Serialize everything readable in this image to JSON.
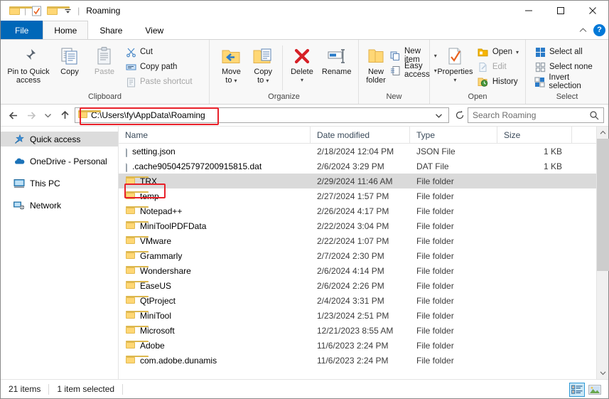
{
  "window": {
    "title": "Roaming",
    "quick_access_icons": [
      "folder-icon",
      "properties-check-icon",
      "new-folder-icon",
      "customize-qat-chevron-icon"
    ],
    "minimize_label": "—",
    "maximize_label": "□",
    "close_label": "✕",
    "ribbon_collapse_label": "∧",
    "help_label": "?"
  },
  "tabs": [
    {
      "label": "File",
      "kind": "file"
    },
    {
      "label": "Home",
      "kind": "active"
    },
    {
      "label": "Share",
      "kind": "normal"
    },
    {
      "label": "View",
      "kind": "normal"
    }
  ],
  "ribbon": {
    "groups": [
      {
        "label": "Clipboard",
        "big_buttons": [
          {
            "label_line1": "Pin to Quick",
            "label_line2": "access",
            "icon": "pin-icon"
          },
          {
            "label_line1": "Copy",
            "label_line2": "",
            "icon": "copy-icon"
          },
          {
            "label_line1": "Paste",
            "label_line2": "",
            "icon": "paste-icon",
            "disabled": true
          }
        ],
        "small_buttons": [
          {
            "label": "Cut",
            "icon": "scissors-icon",
            "disabled": false
          },
          {
            "label": "Copy path",
            "icon": "copy-path-icon",
            "disabled": false
          },
          {
            "label": "Paste shortcut",
            "icon": "paste-shortcut-icon",
            "disabled": true
          }
        ]
      },
      {
        "label": "Organize",
        "big_buttons": [
          {
            "label_line1": "Move",
            "label_line2": "to",
            "icon": "move-to-icon",
            "has_caret": true
          },
          {
            "label_line1": "Copy",
            "label_line2": "to",
            "icon": "copy-to-icon",
            "has_caret": true
          },
          {
            "label_line1": "Delete",
            "label_line2": "",
            "icon": "delete-x-icon",
            "has_caret": true
          },
          {
            "label_line1": "Rename",
            "label_line2": "",
            "icon": "rename-icon"
          }
        ],
        "small_buttons": []
      },
      {
        "label": "New",
        "big_buttons": [
          {
            "label_line1": "New",
            "label_line2": "folder",
            "icon": "new-folder-icon"
          }
        ],
        "small_buttons": [
          {
            "label": "New item",
            "icon": "new-item-icon",
            "has_caret": true
          },
          {
            "label": "Easy access",
            "icon": "easy-access-icon",
            "has_caret": true
          }
        ]
      },
      {
        "label": "Open",
        "big_buttons": [
          {
            "label_line1": "Properties",
            "label_line2": "",
            "icon": "properties-icon",
            "has_caret": true
          }
        ],
        "small_buttons": [
          {
            "label": "Open",
            "icon": "open-folder-icon",
            "has_caret": true
          },
          {
            "label": "Edit",
            "icon": "edit-icon",
            "disabled": true
          },
          {
            "label": "History",
            "icon": "history-icon"
          }
        ]
      },
      {
        "label": "Select",
        "big_buttons": [],
        "small_buttons": [
          {
            "label": "Select all",
            "icon": "select-all-icon"
          },
          {
            "label": "Select none",
            "icon": "select-none-icon"
          },
          {
            "label": "Invert selection",
            "icon": "invert-selection-icon"
          }
        ]
      }
    ]
  },
  "addressbar": {
    "back_label": "←",
    "forward_label": "→",
    "recent_label": "⌄",
    "up_label": "↑",
    "path": "C:\\Users\\fy\\AppData\\Roaming",
    "dropdown_label": "⌄",
    "refresh_label": "↻",
    "search_placeholder": "Search Roaming",
    "search_value": "",
    "search_icon": "magnifier-icon",
    "highlight_color": "#e8212a"
  },
  "navpane": {
    "items": [
      {
        "label": "Quick access",
        "icon": "star-pin-icon",
        "selected": true
      },
      {
        "label": "OneDrive - Personal",
        "icon": "onedrive-cloud-icon",
        "selected": false
      },
      {
        "label": "This PC",
        "icon": "this-pc-monitor-icon",
        "selected": false
      },
      {
        "label": "Network",
        "icon": "network-icon",
        "selected": false
      }
    ]
  },
  "filelist": {
    "columns": [
      "Name",
      "Date modified",
      "Type",
      "Size"
    ],
    "sort_indicator": "⌄",
    "rows": [
      {
        "name": "setting.json",
        "date": "2/18/2024 12:04 PM",
        "type": "JSON File",
        "size": "1 KB",
        "icon": "file-icon",
        "selected": false
      },
      {
        "name": ".cache9050425797200915815.dat",
        "date": "2/6/2024 3:29 PM",
        "type": "DAT File",
        "size": "1 KB",
        "icon": "file-icon",
        "selected": false
      },
      {
        "name": "TRX",
        "date": "2/29/2024 11:46 AM",
        "type": "File folder",
        "size": "",
        "icon": "folder-icon",
        "selected": true
      },
      {
        "name": "temp",
        "date": "2/27/2024 1:57 PM",
        "type": "File folder",
        "size": "",
        "icon": "folder-icon",
        "selected": false
      },
      {
        "name": "Notepad++",
        "date": "2/26/2024 4:17 PM",
        "type": "File folder",
        "size": "",
        "icon": "folder-icon",
        "selected": false
      },
      {
        "name": "MiniToolPDFData",
        "date": "2/22/2024 3:04 PM",
        "type": "File folder",
        "size": "",
        "icon": "folder-icon",
        "selected": false
      },
      {
        "name": "VMware",
        "date": "2/22/2024 1:07 PM",
        "type": "File folder",
        "size": "",
        "icon": "folder-icon",
        "selected": false
      },
      {
        "name": "Grammarly",
        "date": "2/7/2024 2:30 PM",
        "type": "File folder",
        "size": "",
        "icon": "folder-icon",
        "selected": false
      },
      {
        "name": "Wondershare",
        "date": "2/6/2024 4:14 PM",
        "type": "File folder",
        "size": "",
        "icon": "folder-icon",
        "selected": false
      },
      {
        "name": "EaseUS",
        "date": "2/6/2024 2:26 PM",
        "type": "File folder",
        "size": "",
        "icon": "folder-icon",
        "selected": false
      },
      {
        "name": "QtProject",
        "date": "2/4/2024 3:31 PM",
        "type": "File folder",
        "size": "",
        "icon": "folder-icon",
        "selected": false
      },
      {
        "name": "MiniTool",
        "date": "1/23/2024 2:51 PM",
        "type": "File folder",
        "size": "",
        "icon": "folder-icon",
        "selected": false
      },
      {
        "name": "Microsoft",
        "date": "12/21/2023 8:55 AM",
        "type": "File folder",
        "size": "",
        "icon": "folder-icon",
        "selected": false
      },
      {
        "name": "Adobe",
        "date": "11/6/2023 2:24 PM",
        "type": "File folder",
        "size": "",
        "icon": "folder-icon",
        "selected": false
      },
      {
        "name": "com.adobe.dunamis",
        "date": "11/6/2023 2:24 PM",
        "type": "File folder",
        "size": "",
        "icon": "folder-icon",
        "selected": false
      }
    ],
    "scroll_up_label": "∧",
    "scroll_down_label": "∨"
  },
  "statusbar": {
    "item_count": "21 items",
    "selection_count": "1 item selected",
    "view_buttons": [
      {
        "name": "details-view-button",
        "icon": "details-view-icon",
        "active": true
      },
      {
        "name": "large-icons-view-button",
        "icon": "large-icons-view-icon",
        "active": false
      }
    ]
  }
}
